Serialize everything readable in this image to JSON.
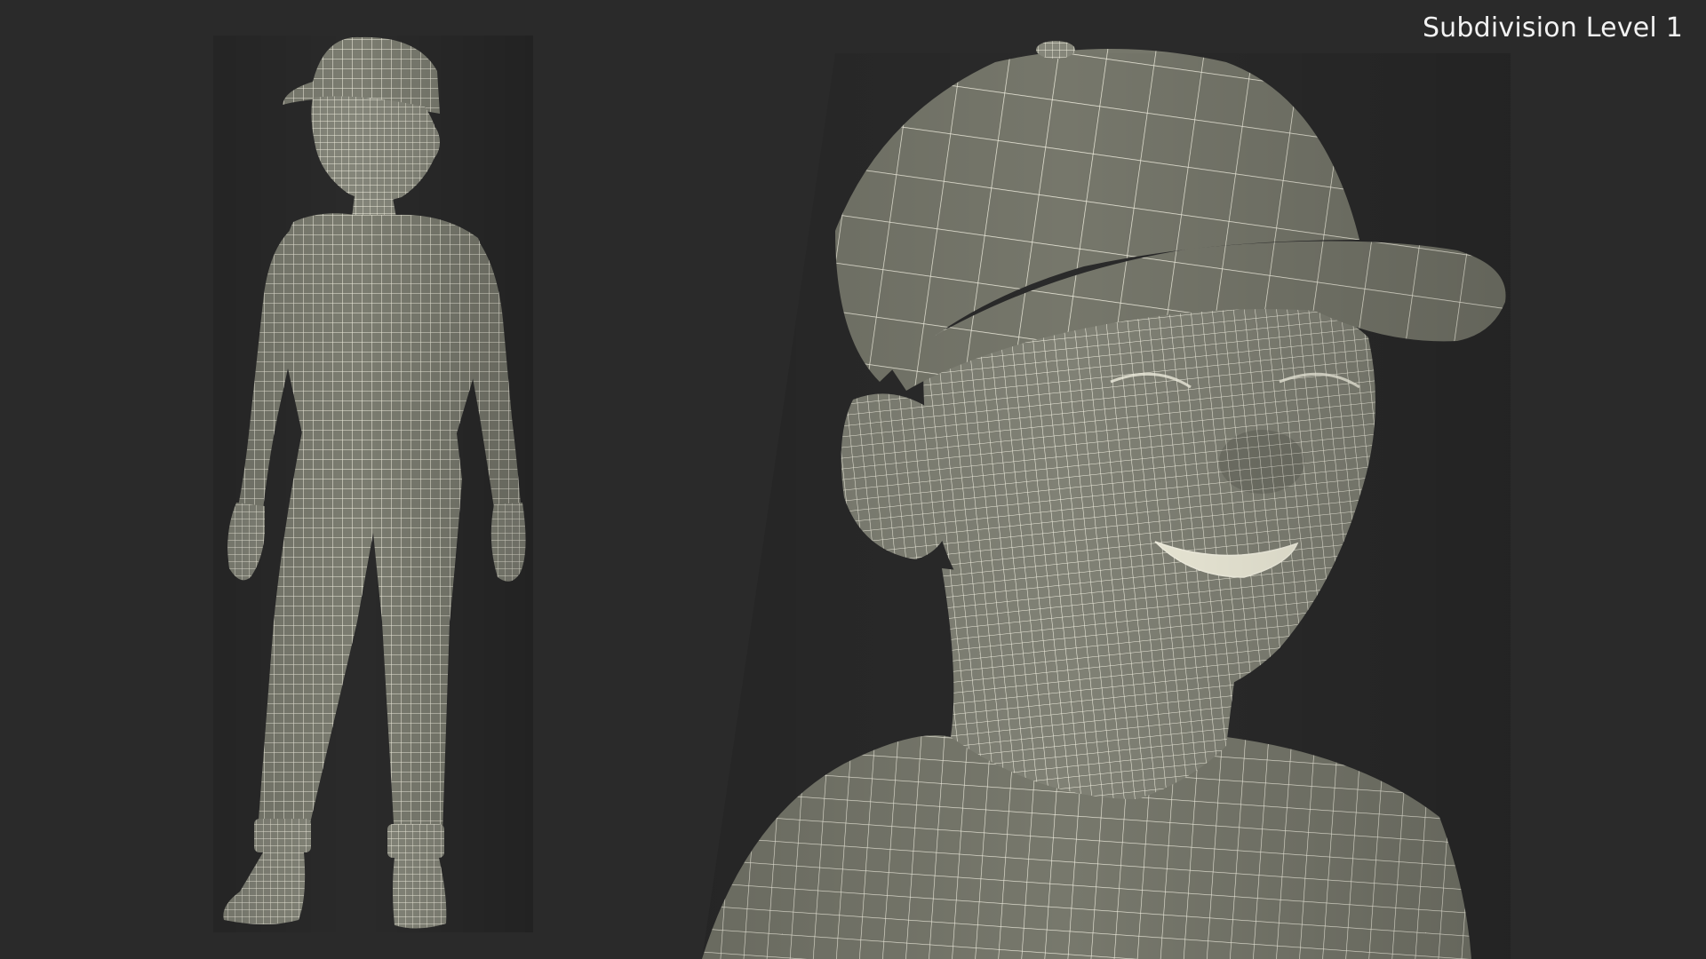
{
  "viewport": {
    "overlay_label": "Subdivision Level 1"
  },
  "colors": {
    "background": "#2a2a2a",
    "mesh_surface": "#7e7f73",
    "mesh_shadow": "#5a5b51",
    "wire": "#f3f1e2",
    "label_text": "#f2f2f2"
  },
  "figures": [
    {
      "kind": "full-body",
      "subject": "child-with-cap"
    },
    {
      "kind": "head-closeup",
      "subject": "child-with-cap"
    }
  ]
}
